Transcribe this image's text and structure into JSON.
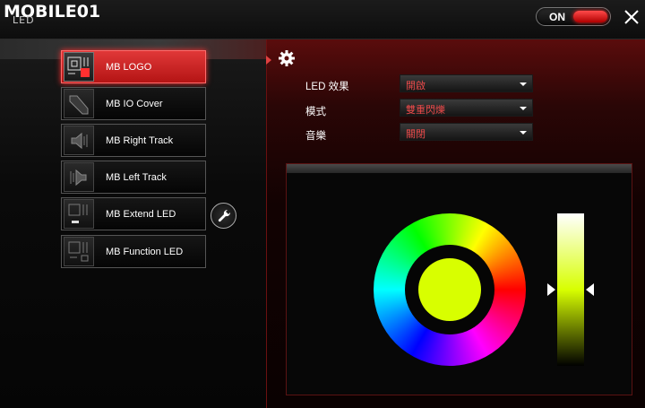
{
  "app": {
    "logo": "MOBILE01",
    "logo_sub": "LED",
    "power_label": "ON"
  },
  "sidebar": {
    "items": [
      {
        "label": "MB LOGO",
        "active": true
      },
      {
        "label": "MB IO Cover",
        "active": false
      },
      {
        "label": "MB Right Track",
        "active": false
      },
      {
        "label": "MB Left Track",
        "active": false
      },
      {
        "label": "MB Extend LED",
        "active": false
      },
      {
        "label": "MB Function LED",
        "active": false
      }
    ]
  },
  "settings": {
    "led_effect": {
      "label": "LED 效果",
      "value": "開啟"
    },
    "mode": {
      "label": "模式",
      "value": "雙重閃爍"
    },
    "music": {
      "label": "音樂",
      "value": "關閉"
    }
  },
  "colors": {
    "accent": "#d42020",
    "selected_color": "#d8ff00",
    "dropdown_text": "#e84a4a"
  },
  "icons": {
    "close": "close-icon",
    "gear": "gear-icon",
    "wrench": "wrench-icon"
  }
}
